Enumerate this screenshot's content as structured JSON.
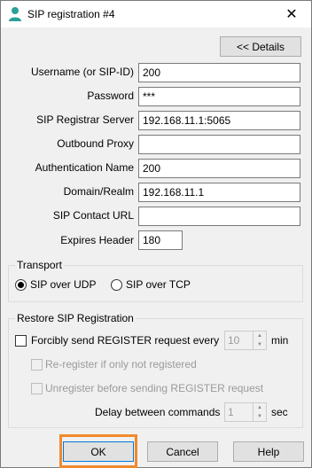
{
  "window": {
    "title": "SIP registration #4",
    "close_glyph": "✕"
  },
  "details_button": "<< Details",
  "fields": {
    "username": {
      "label": "Username (or SIP-ID)",
      "value": "200"
    },
    "password": {
      "label": "Password",
      "value": "***"
    },
    "registrar": {
      "label": "SIP Registrar Server",
      "value": "192.168.11.1:5065"
    },
    "proxy": {
      "label": "Outbound Proxy",
      "value": ""
    },
    "auth_name": {
      "label": "Authentication Name",
      "value": "200"
    },
    "domain": {
      "label": "Domain/Realm",
      "value": "192.168.11.1"
    },
    "contact_url": {
      "label": "SIP Contact URL",
      "value": ""
    },
    "expires": {
      "label": "Expires Header",
      "value": "180"
    }
  },
  "transport": {
    "title": "Transport",
    "udp_label": "SIP over UDP",
    "tcp_label": "SIP over TCP",
    "selected": "udp"
  },
  "restore": {
    "title": "Restore SIP Registration",
    "force_label": "Forcibly send REGISTER request every",
    "force_interval": "10",
    "force_unit": "min",
    "reregister_label": "Re-register if only not registered",
    "unregister_label": "Unregister before sending REGISTER request",
    "delay_label": "Delay between commands",
    "delay_value": "1",
    "delay_unit": "sec"
  },
  "buttons": {
    "ok": "OK",
    "cancel": "Cancel",
    "help": "Help"
  },
  "colors": {
    "focus_highlight": "#f08a2c",
    "accent": "#0078d7"
  }
}
